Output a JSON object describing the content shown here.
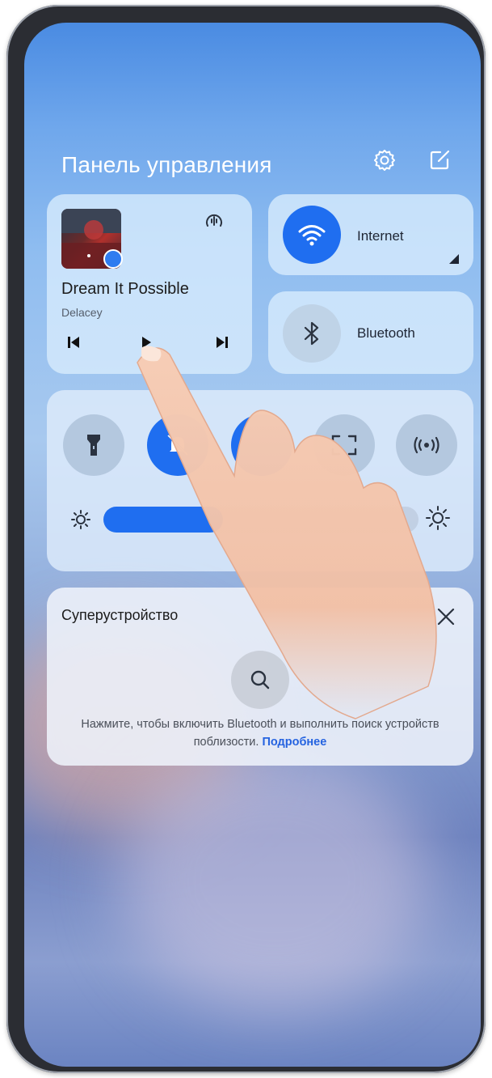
{
  "header": {
    "title": "Панель управления",
    "settings_icon": "gear-icon",
    "edit_icon": "edit-icon"
  },
  "media": {
    "song_title": "Dream It Possible",
    "artist": "Delacey",
    "cast_icon": "audio-cast-icon",
    "prev_icon": "skip-previous-icon",
    "play_icon": "play-pause-icon",
    "next_icon": "skip-next-icon"
  },
  "internet": {
    "label": "Internet",
    "icon": "wifi-icon",
    "active": true,
    "accent": "#1f6ef0"
  },
  "bluetooth": {
    "label": "Bluetooth",
    "icon": "bluetooth-icon",
    "active": false
  },
  "toggles": [
    {
      "icon": "flashlight-icon",
      "active": false
    },
    {
      "icon": "bell-off-icon",
      "active": true
    },
    {
      "icon": "toggle-icon",
      "active": true
    },
    {
      "icon": "screenshot-icon",
      "active": false
    },
    {
      "icon": "hotspot-icon",
      "active": false
    }
  ],
  "brightness": {
    "level": 0.38,
    "low_icon": "brightness-low-icon",
    "high_icon": "brightness-high-icon"
  },
  "superdevice": {
    "title": "Суперустройство",
    "close_icon": "close-icon",
    "search_icon": "search-icon",
    "message": "Нажмите, чтобы включить Bluetooth и выполнить поиск устройств поблизости.",
    "link": "Подробнее"
  },
  "colors": {
    "accent": "#1f6ef0",
    "link": "#2563e0"
  }
}
